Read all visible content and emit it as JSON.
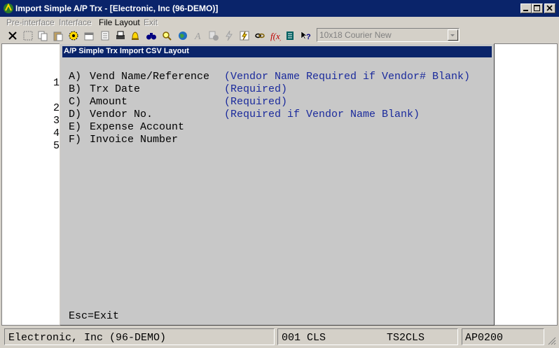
{
  "window": {
    "title": "Import Simple A/P Trx - [Electronic, Inc (96-DEMO)]"
  },
  "menu": [
    {
      "label": "Pre-interface",
      "enabled": false
    },
    {
      "label": "Interface",
      "enabled": false
    },
    {
      "label": "File Layout",
      "enabled": true
    },
    {
      "label": "Exit",
      "enabled": false
    }
  ],
  "toolbar": {
    "font_combo": "10x18 Courier New"
  },
  "background_digits": [
    "1",
    "2",
    "3",
    "4",
    "5"
  ],
  "dialog": {
    "title": "A/P Simple Trx Import CSV Layout",
    "fields": [
      {
        "key": "A)",
        "name": "Vend Name/Reference",
        "note": "(Vendor Name Required if Vendor# Blank)"
      },
      {
        "key": "B)",
        "name": "Trx Date",
        "note": "(Required)"
      },
      {
        "key": "C)",
        "name": "Amount",
        "note": "(Required)"
      },
      {
        "key": "D)",
        "name": "Vendor No.",
        "note": "(Required if Vendor Name Blank)"
      },
      {
        "key": "E)",
        "name": "Expense Account",
        "note": ""
      },
      {
        "key": "F)",
        "name": "Invoice Number",
        "note": ""
      }
    ],
    "footer": "Esc=Exit"
  },
  "status": {
    "company": "Electronic, Inc (96-DEMO)",
    "code": "001 CLS",
    "screen": "TS2CLS",
    "program": "AP0200"
  },
  "colors": {
    "title_bar": "#0a246a",
    "note_text": "#1a2a9c",
    "dialog_bg": "#c8c8c8"
  }
}
